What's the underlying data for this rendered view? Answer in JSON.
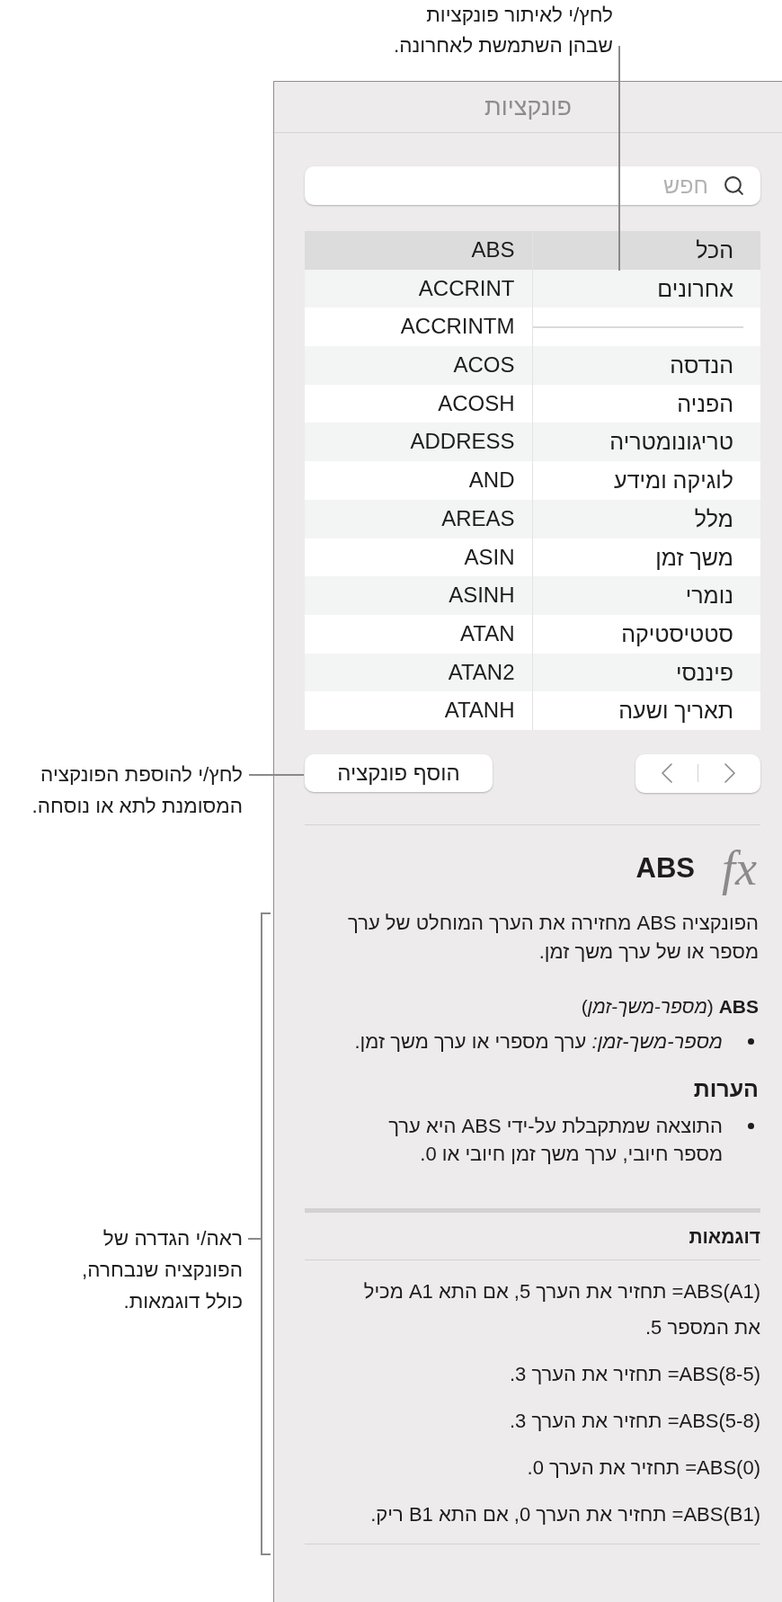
{
  "callouts": {
    "recent": {
      "lines": [
        "לחץ/י לאיתור פונקציות",
        "שבהן השתמשת לאחרונה."
      ]
    },
    "insert": {
      "lines": [
        "לחץ/י להוספת הפונקציה",
        "המסומנת לתא או נוסחה."
      ]
    },
    "definition": {
      "lines": [
        "ראה/י הגדרה של",
        "הפונקציה שנבחרה,",
        "כולל דוגמאות."
      ]
    }
  },
  "panel": {
    "title": "פונקציות",
    "search": {
      "placeholder": "חפש"
    },
    "categories": [
      {
        "kind": "item",
        "label": "הכל",
        "selected": true
      },
      {
        "kind": "item",
        "label": "אחרונים",
        "selected": false
      },
      {
        "kind": "separator"
      },
      {
        "kind": "item",
        "label": "הנדסה",
        "selected": false
      },
      {
        "kind": "item",
        "label": "הפניה",
        "selected": false
      },
      {
        "kind": "item",
        "label": "טריגונומטריה",
        "selected": false
      },
      {
        "kind": "item",
        "label": "לוגיקה ומידע",
        "selected": false
      },
      {
        "kind": "item",
        "label": "מלל",
        "selected": false
      },
      {
        "kind": "item",
        "label": "משך זמן",
        "selected": false
      },
      {
        "kind": "item",
        "label": "נומרי",
        "selected": false
      },
      {
        "kind": "item",
        "label": "סטטיסטיקה",
        "selected": false
      },
      {
        "kind": "item",
        "label": "פיננסי",
        "selected": false
      },
      {
        "kind": "item",
        "label": "תאריך ושעה",
        "selected": false
      }
    ],
    "functions": [
      {
        "name": "ABS",
        "selected": true
      },
      {
        "name": "ACCRINT",
        "selected": false
      },
      {
        "name": "ACCRINTM",
        "selected": false
      },
      {
        "name": "ACOS",
        "selected": false
      },
      {
        "name": "ACOSH",
        "selected": false
      },
      {
        "name": "ADDRESS",
        "selected": false
      },
      {
        "name": "AND",
        "selected": false
      },
      {
        "name": "AREAS",
        "selected": false
      },
      {
        "name": "ASIN",
        "selected": false
      },
      {
        "name": "ASINH",
        "selected": false
      },
      {
        "name": "ATAN",
        "selected": false
      },
      {
        "name": "ATAN2",
        "selected": false
      },
      {
        "name": "ATANH",
        "selected": false
      }
    ],
    "insert_button": "הוסף פונקציה",
    "detail": {
      "icon": "fx",
      "title": "ABS",
      "summary": "הפונקציה ABS מחזירה את הערך המוחלט של ערך מספר או של ערך משך זמן.",
      "syntax": "**ABS** (*מספר-משך-זמן*)",
      "arguments": [
        "*מספר-משך-זמן:* ערך מספרי או ערך משך זמן."
      ],
      "notes_heading": "הערות",
      "notes": [
        "התוצאה שמתקבלת על-ידי ABS היא ערך מספר חיובי, ערך משך זמן חיובי או 0."
      ],
      "examples_heading": "דוגמאות",
      "examples": [
        {
          "formula": "=ABS(A1)",
          "text": "תחזיר את הערך 5, אם התא A1 מכיל את המספר 5."
        },
        {
          "formula": "=ABS(8-5)",
          "text": "תחזיר את הערך 3."
        },
        {
          "formula": "=ABS(5-8)",
          "text": "תחזיר את הערך 3."
        },
        {
          "formula": "=ABS(0)",
          "text": "תחזיר את הערך 0."
        },
        {
          "formula": "=ABS(B1)",
          "text": "תחזיר את הערך 0, אם התא B1 ריק."
        }
      ]
    }
  }
}
